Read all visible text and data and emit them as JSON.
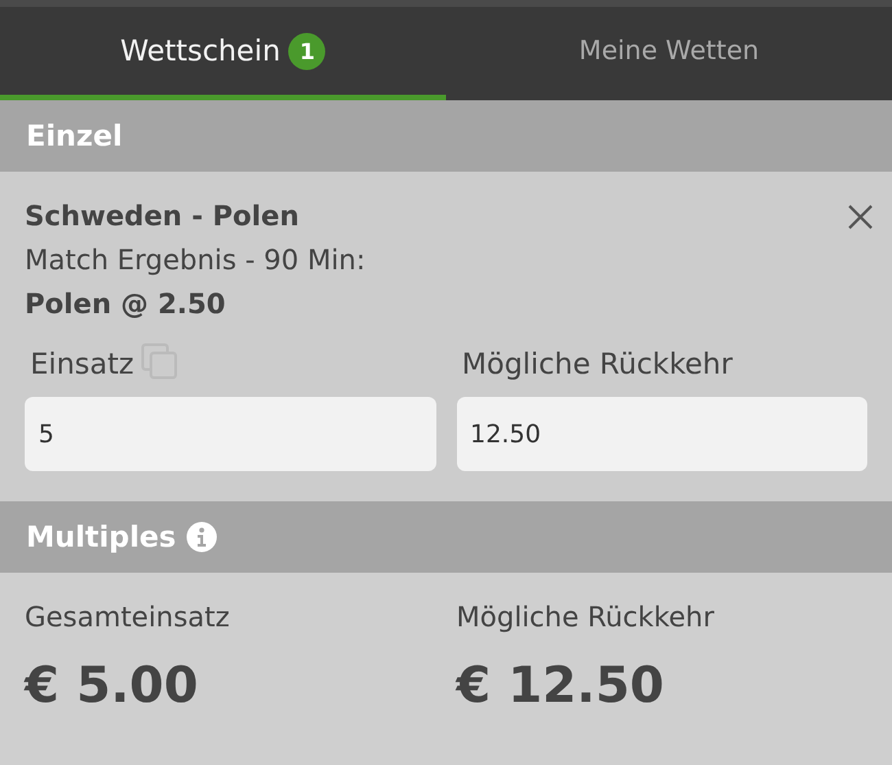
{
  "tabs": [
    {
      "label": "Wettschein",
      "badge": "1",
      "selected": true
    },
    {
      "label": "Meine Wetten",
      "selected": false
    }
  ],
  "single": {
    "title": "Einzel",
    "match": "Schweden - Polen",
    "market": "Match Ergebnis - 90 Min:",
    "selection": "Polen @ 2.50",
    "stake": {
      "label": "Einsatz",
      "value": "5"
    },
    "return": {
      "label": "Mögliche Rückkehr",
      "value": "12.50"
    }
  },
  "multiples": {
    "title": "Multiples",
    "total_label": "Gesamteinsatz",
    "total_value": "€ 5.00",
    "return_label": "Mögliche Rückkehr",
    "return_value": "€ 12.50"
  }
}
